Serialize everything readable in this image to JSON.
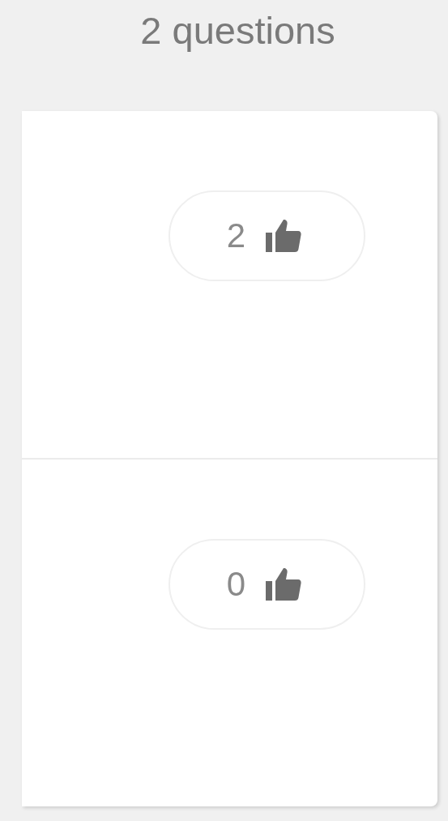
{
  "header": {
    "title": "2 questions"
  },
  "questions": [
    {
      "votes": "2"
    },
    {
      "votes": "0"
    }
  ]
}
